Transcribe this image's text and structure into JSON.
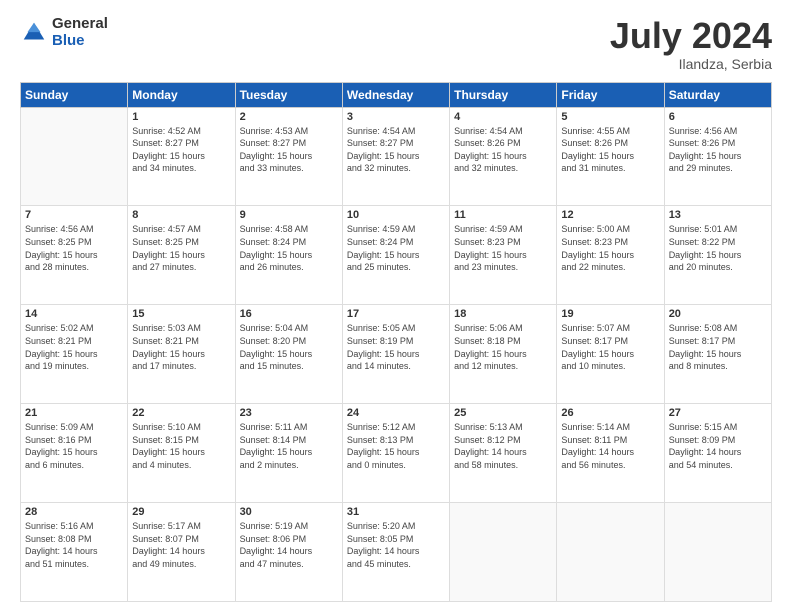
{
  "header": {
    "logo_general": "General",
    "logo_blue": "Blue",
    "month_year": "July 2024",
    "location": "Ilandza, Serbia"
  },
  "days_of_week": [
    "Sunday",
    "Monday",
    "Tuesday",
    "Wednesday",
    "Thursday",
    "Friday",
    "Saturday"
  ],
  "weeks": [
    [
      {
        "day": "",
        "info": ""
      },
      {
        "day": "1",
        "info": "Sunrise: 4:52 AM\nSunset: 8:27 PM\nDaylight: 15 hours\nand 34 minutes."
      },
      {
        "day": "2",
        "info": "Sunrise: 4:53 AM\nSunset: 8:27 PM\nDaylight: 15 hours\nand 33 minutes."
      },
      {
        "day": "3",
        "info": "Sunrise: 4:54 AM\nSunset: 8:27 PM\nDaylight: 15 hours\nand 32 minutes."
      },
      {
        "day": "4",
        "info": "Sunrise: 4:54 AM\nSunset: 8:26 PM\nDaylight: 15 hours\nand 32 minutes."
      },
      {
        "day": "5",
        "info": "Sunrise: 4:55 AM\nSunset: 8:26 PM\nDaylight: 15 hours\nand 31 minutes."
      },
      {
        "day": "6",
        "info": "Sunrise: 4:56 AM\nSunset: 8:26 PM\nDaylight: 15 hours\nand 29 minutes."
      }
    ],
    [
      {
        "day": "7",
        "info": "Sunrise: 4:56 AM\nSunset: 8:25 PM\nDaylight: 15 hours\nand 28 minutes."
      },
      {
        "day": "8",
        "info": "Sunrise: 4:57 AM\nSunset: 8:25 PM\nDaylight: 15 hours\nand 27 minutes."
      },
      {
        "day": "9",
        "info": "Sunrise: 4:58 AM\nSunset: 8:24 PM\nDaylight: 15 hours\nand 26 minutes."
      },
      {
        "day": "10",
        "info": "Sunrise: 4:59 AM\nSunset: 8:24 PM\nDaylight: 15 hours\nand 25 minutes."
      },
      {
        "day": "11",
        "info": "Sunrise: 4:59 AM\nSunset: 8:23 PM\nDaylight: 15 hours\nand 23 minutes."
      },
      {
        "day": "12",
        "info": "Sunrise: 5:00 AM\nSunset: 8:23 PM\nDaylight: 15 hours\nand 22 minutes."
      },
      {
        "day": "13",
        "info": "Sunrise: 5:01 AM\nSunset: 8:22 PM\nDaylight: 15 hours\nand 20 minutes."
      }
    ],
    [
      {
        "day": "14",
        "info": "Sunrise: 5:02 AM\nSunset: 8:21 PM\nDaylight: 15 hours\nand 19 minutes."
      },
      {
        "day": "15",
        "info": "Sunrise: 5:03 AM\nSunset: 8:21 PM\nDaylight: 15 hours\nand 17 minutes."
      },
      {
        "day": "16",
        "info": "Sunrise: 5:04 AM\nSunset: 8:20 PM\nDaylight: 15 hours\nand 15 minutes."
      },
      {
        "day": "17",
        "info": "Sunrise: 5:05 AM\nSunset: 8:19 PM\nDaylight: 15 hours\nand 14 minutes."
      },
      {
        "day": "18",
        "info": "Sunrise: 5:06 AM\nSunset: 8:18 PM\nDaylight: 15 hours\nand 12 minutes."
      },
      {
        "day": "19",
        "info": "Sunrise: 5:07 AM\nSunset: 8:17 PM\nDaylight: 15 hours\nand 10 minutes."
      },
      {
        "day": "20",
        "info": "Sunrise: 5:08 AM\nSunset: 8:17 PM\nDaylight: 15 hours\nand 8 minutes."
      }
    ],
    [
      {
        "day": "21",
        "info": "Sunrise: 5:09 AM\nSunset: 8:16 PM\nDaylight: 15 hours\nand 6 minutes."
      },
      {
        "day": "22",
        "info": "Sunrise: 5:10 AM\nSunset: 8:15 PM\nDaylight: 15 hours\nand 4 minutes."
      },
      {
        "day": "23",
        "info": "Sunrise: 5:11 AM\nSunset: 8:14 PM\nDaylight: 15 hours\nand 2 minutes."
      },
      {
        "day": "24",
        "info": "Sunrise: 5:12 AM\nSunset: 8:13 PM\nDaylight: 15 hours\nand 0 minutes."
      },
      {
        "day": "25",
        "info": "Sunrise: 5:13 AM\nSunset: 8:12 PM\nDaylight: 14 hours\nand 58 minutes."
      },
      {
        "day": "26",
        "info": "Sunrise: 5:14 AM\nSunset: 8:11 PM\nDaylight: 14 hours\nand 56 minutes."
      },
      {
        "day": "27",
        "info": "Sunrise: 5:15 AM\nSunset: 8:09 PM\nDaylight: 14 hours\nand 54 minutes."
      }
    ],
    [
      {
        "day": "28",
        "info": "Sunrise: 5:16 AM\nSunset: 8:08 PM\nDaylight: 14 hours\nand 51 minutes."
      },
      {
        "day": "29",
        "info": "Sunrise: 5:17 AM\nSunset: 8:07 PM\nDaylight: 14 hours\nand 49 minutes."
      },
      {
        "day": "30",
        "info": "Sunrise: 5:19 AM\nSunset: 8:06 PM\nDaylight: 14 hours\nand 47 minutes."
      },
      {
        "day": "31",
        "info": "Sunrise: 5:20 AM\nSunset: 8:05 PM\nDaylight: 14 hours\nand 45 minutes."
      },
      {
        "day": "",
        "info": ""
      },
      {
        "day": "",
        "info": ""
      },
      {
        "day": "",
        "info": ""
      }
    ]
  ]
}
